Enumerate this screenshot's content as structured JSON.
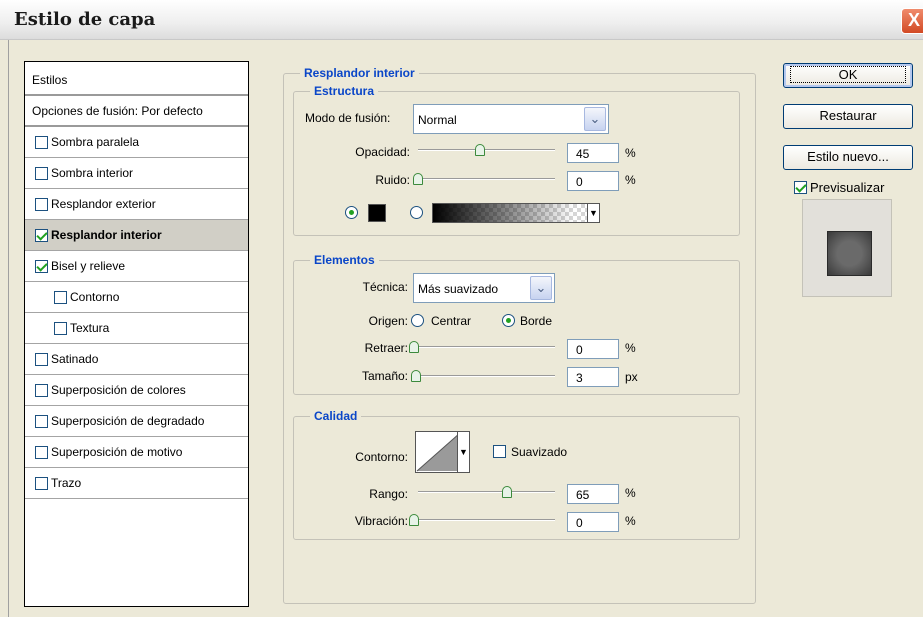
{
  "window": {
    "title": "Estilo de capa",
    "close": "X"
  },
  "styles": {
    "header": "Estilos",
    "items": [
      {
        "label": "Opciones de fusión: Por defecto",
        "checkbox": false,
        "checked": false,
        "selected": false,
        "indent": false
      },
      {
        "label": "Sombra paralela",
        "checkbox": true,
        "checked": false,
        "selected": false,
        "indent": false
      },
      {
        "label": "Sombra interior",
        "checkbox": true,
        "checked": false,
        "selected": false,
        "indent": false
      },
      {
        "label": "Resplandor exterior",
        "checkbox": true,
        "checked": false,
        "selected": false,
        "indent": false
      },
      {
        "label": "Resplandor interior",
        "checkbox": true,
        "checked": true,
        "selected": true,
        "indent": false
      },
      {
        "label": "Bisel y relieve",
        "checkbox": true,
        "checked": true,
        "selected": false,
        "indent": false
      },
      {
        "label": "Contorno",
        "checkbox": true,
        "checked": false,
        "selected": false,
        "indent": true
      },
      {
        "label": "Textura",
        "checkbox": true,
        "checked": false,
        "selected": false,
        "indent": true
      },
      {
        "label": "Satinado",
        "checkbox": true,
        "checked": false,
        "selected": false,
        "indent": false
      },
      {
        "label": "Superposición de colores",
        "checkbox": true,
        "checked": false,
        "selected": false,
        "indent": false
      },
      {
        "label": "Superposición de degradado",
        "checkbox": true,
        "checked": false,
        "selected": false,
        "indent": false
      },
      {
        "label": "Superposición de motivo",
        "checkbox": true,
        "checked": false,
        "selected": false,
        "indent": false
      },
      {
        "label": "Trazo",
        "checkbox": true,
        "checked": false,
        "selected": false,
        "indent": false
      }
    ]
  },
  "panel": {
    "title": "Resplandor interior",
    "estructura": {
      "title": "Estructura",
      "blend_mode_label": "Modo de fusión:",
      "blend_mode_value": "Normal",
      "opacity_label": "Opacidad:",
      "opacity_value": "45",
      "opacity_unit": "%",
      "opacity_fraction": 0.45,
      "noise_label": "Ruido:",
      "noise_value": "0",
      "noise_unit": "%",
      "noise_fraction": 0.0,
      "color_mode": "solid",
      "solid_color": "#000000"
    },
    "elementos": {
      "title": "Elementos",
      "technique_label": "Técnica:",
      "technique_value": "Más suavizado",
      "source_label": "Origen:",
      "source_center": "Centrar",
      "source_edge": "Borde",
      "source_selected": "Borde",
      "choke_label": "Retraer:",
      "choke_value": "0",
      "choke_unit": "%",
      "choke_fraction": 0.0,
      "size_label": "Tamaño:",
      "size_value": "3",
      "size_unit": "px",
      "size_fraction": 0.012
    },
    "calidad": {
      "title": "Calidad",
      "contour_label": "Contorno:",
      "antialias_label": "Suavizado",
      "antialias_checked": false,
      "range_label": "Rango:",
      "range_value": "65",
      "range_unit": "%",
      "range_fraction": 0.65,
      "jitter_label": "Vibración:",
      "jitter_value": "0",
      "jitter_unit": "%",
      "jitter_fraction": 0.0
    }
  },
  "buttons": {
    "ok": "OK",
    "reset": "Restaurar",
    "new_style": "Estilo nuevo..."
  },
  "preview": {
    "label": "Previsualizar",
    "checked": true
  }
}
